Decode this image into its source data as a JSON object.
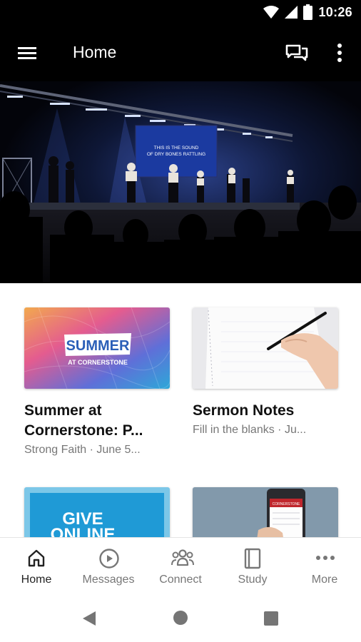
{
  "status_bar": {
    "time": "10:26"
  },
  "app_bar": {
    "title": "Home"
  },
  "hero": {
    "screen_text_line1": "THIS IS THE SOUND",
    "screen_text_line2": "OF DRY BONES RATTLING"
  },
  "cards": [
    {
      "title_line1": "Summer at",
      "title_line2": "Cornerstone: P...",
      "subtitle": "Strong Faith · June 5...",
      "thumb_text1": "SUMMER",
      "thumb_text2": "AT CORNERSTONE"
    },
    {
      "title_line1": "Sermon Notes",
      "title_line2": "",
      "subtitle": "Fill in the blanks · Ju..."
    },
    {
      "thumb_text1": "GIVE",
      "thumb_text2": "ONLINE"
    },
    {
      "thumb_text1": "CORNERSTONE"
    }
  ],
  "bottom_nav": [
    {
      "label": "Home",
      "icon": "home-icon",
      "active": true
    },
    {
      "label": "Messages",
      "icon": "play-circle-icon"
    },
    {
      "label": "Connect",
      "icon": "people-icon"
    },
    {
      "label": "Study",
      "icon": "book-icon"
    },
    {
      "label": "More",
      "icon": "more-horizontal-icon"
    }
  ],
  "colors": {
    "bars": "#000000",
    "active_nav": "#222222",
    "inactive_nav": "#777777",
    "give_blue": "#1f9ad6"
  }
}
